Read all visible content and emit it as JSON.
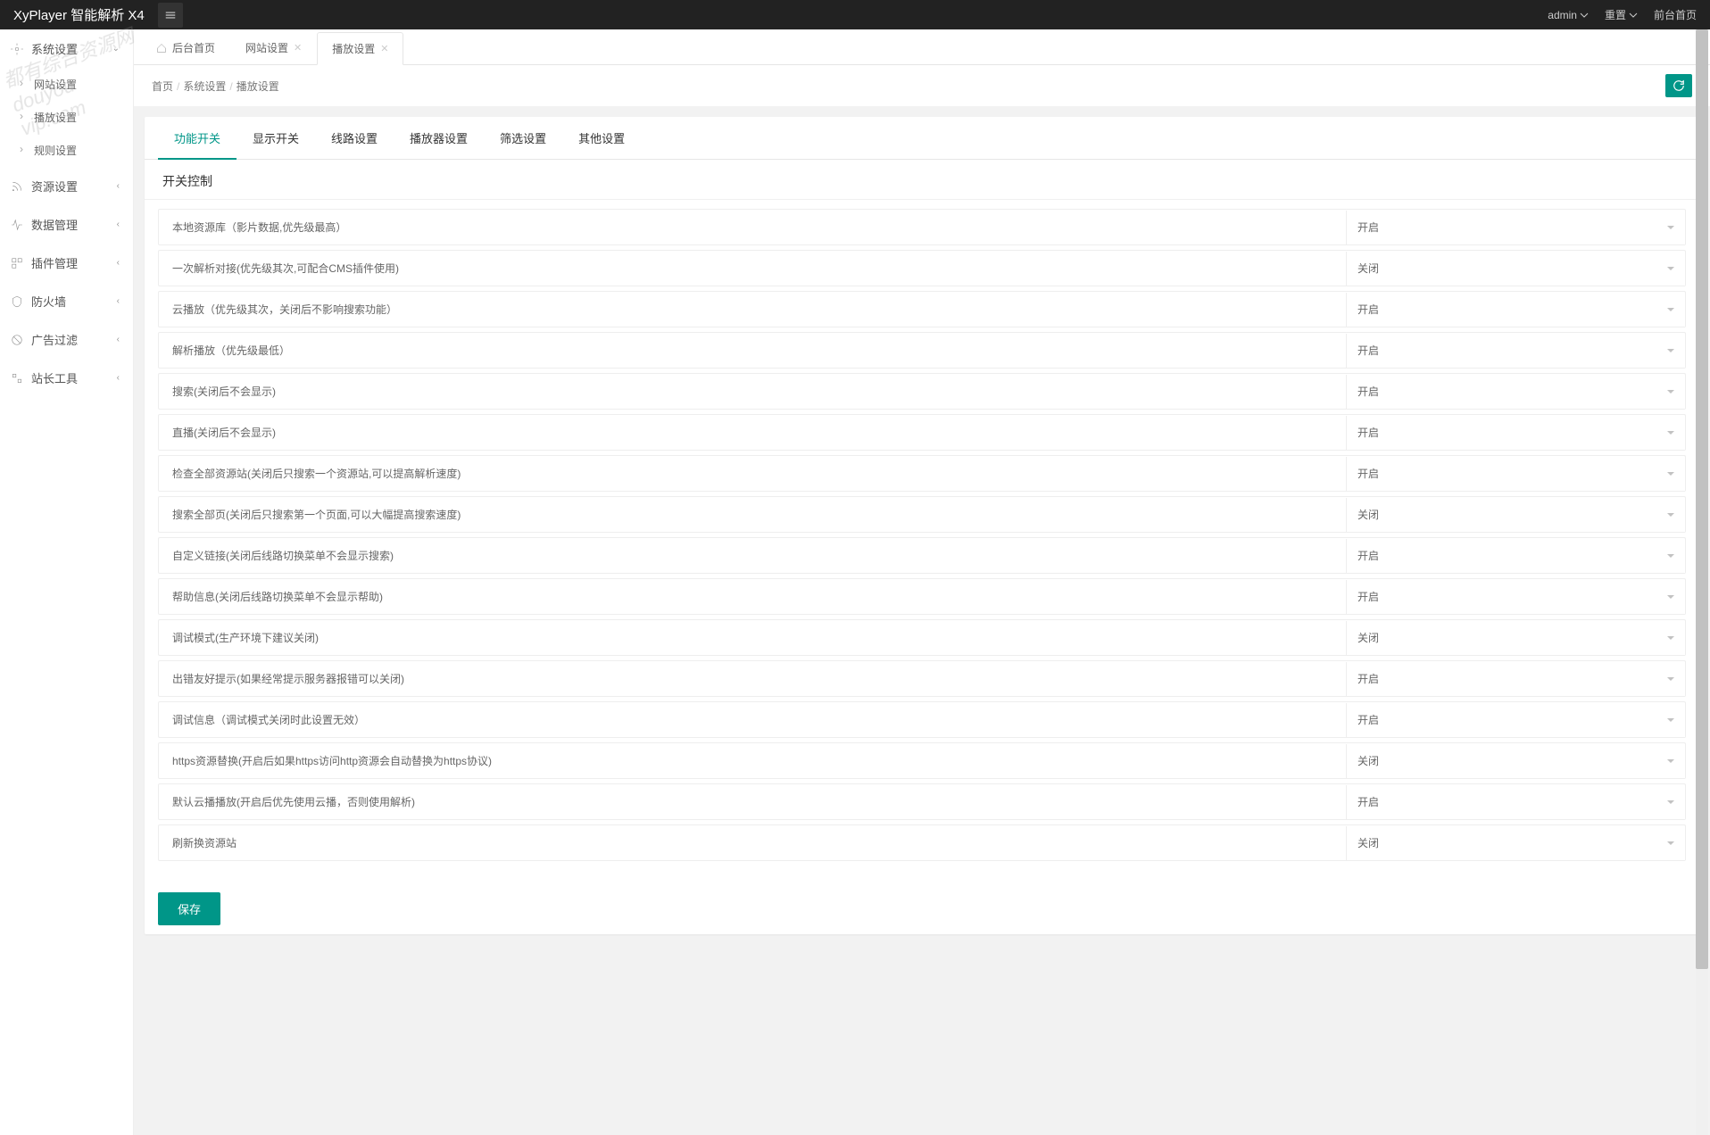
{
  "header": {
    "logo": "XyPlayer 智能解析 X4",
    "user": "admin",
    "reset": "重置",
    "frontend": "前台首页"
  },
  "sidebar": {
    "items": [
      {
        "label": "系统设置",
        "expanded": true
      },
      {
        "label": "资源设置",
        "expanded": false
      },
      {
        "label": "数据管理",
        "expanded": false
      },
      {
        "label": "插件管理",
        "expanded": false
      },
      {
        "label": "防火墙",
        "expanded": false
      },
      {
        "label": "广告过滤",
        "expanded": false
      },
      {
        "label": "站长工具",
        "expanded": false
      }
    ],
    "subs": [
      "网站设置",
      "播放设置",
      "规则设置"
    ]
  },
  "tabs": [
    {
      "label": "后台首页",
      "closable": false,
      "home": true
    },
    {
      "label": "网站设置",
      "closable": true
    },
    {
      "label": "播放设置",
      "closable": true,
      "active": true
    }
  ],
  "breadcrumb": {
    "a": "首页",
    "b": "系统设置",
    "c": "播放设置"
  },
  "inner_tabs": [
    "功能开关",
    "显示开关",
    "线路设置",
    "播放器设置",
    "筛选设置",
    "其他设置"
  ],
  "section_title": "开关控制",
  "options": {
    "on": "开启",
    "off": "关闭"
  },
  "rows": [
    {
      "label": "本地资源库（影片数据,优先级最高）",
      "value": "开启"
    },
    {
      "label": "一次解析对接(优先级其次,可配合CMS插件使用)",
      "value": "关闭"
    },
    {
      "label": "云播放（优先级其次，关闭后不影响搜索功能）",
      "value": "开启"
    },
    {
      "label": "解析播放（优先级最低）",
      "value": "开启"
    },
    {
      "label": "搜索(关闭后不会显示)",
      "value": "开启"
    },
    {
      "label": "直播(关闭后不会显示)",
      "value": "开启"
    },
    {
      "label": "检查全部资源站(关闭后只搜索一个资源站,可以提高解析速度)",
      "value": "开启"
    },
    {
      "label": "搜索全部页(关闭后只搜索第一个页面,可以大幅提高搜索速度)",
      "value": "关闭"
    },
    {
      "label": "自定义链接(关闭后线路切换菜单不会显示搜索)",
      "value": "开启"
    },
    {
      "label": "帮助信息(关闭后线路切换菜单不会显示帮助)",
      "value": "开启"
    },
    {
      "label": "调试模式(生产环境下建议关闭)",
      "value": "关闭"
    },
    {
      "label": "出错友好提示(如果经常提示服务器报错可以关闭)",
      "value": "开启"
    },
    {
      "label": "调试信息（调试模式关闭时此设置无效）",
      "value": "开启"
    },
    {
      "label": "https资源替换(开启后如果https访问http资源会自动替换为https协议)",
      "value": "关闭"
    },
    {
      "label": "默认云播播放(开启后优先使用云播，否则使用解析)",
      "value": "开启"
    },
    {
      "label": "刷新换资源站",
      "value": "关闭"
    }
  ],
  "save": "保存",
  "watermark": {
    "l1": "都有综合资源网",
    "l2": "douyou",
    "l3": "vip.com"
  }
}
